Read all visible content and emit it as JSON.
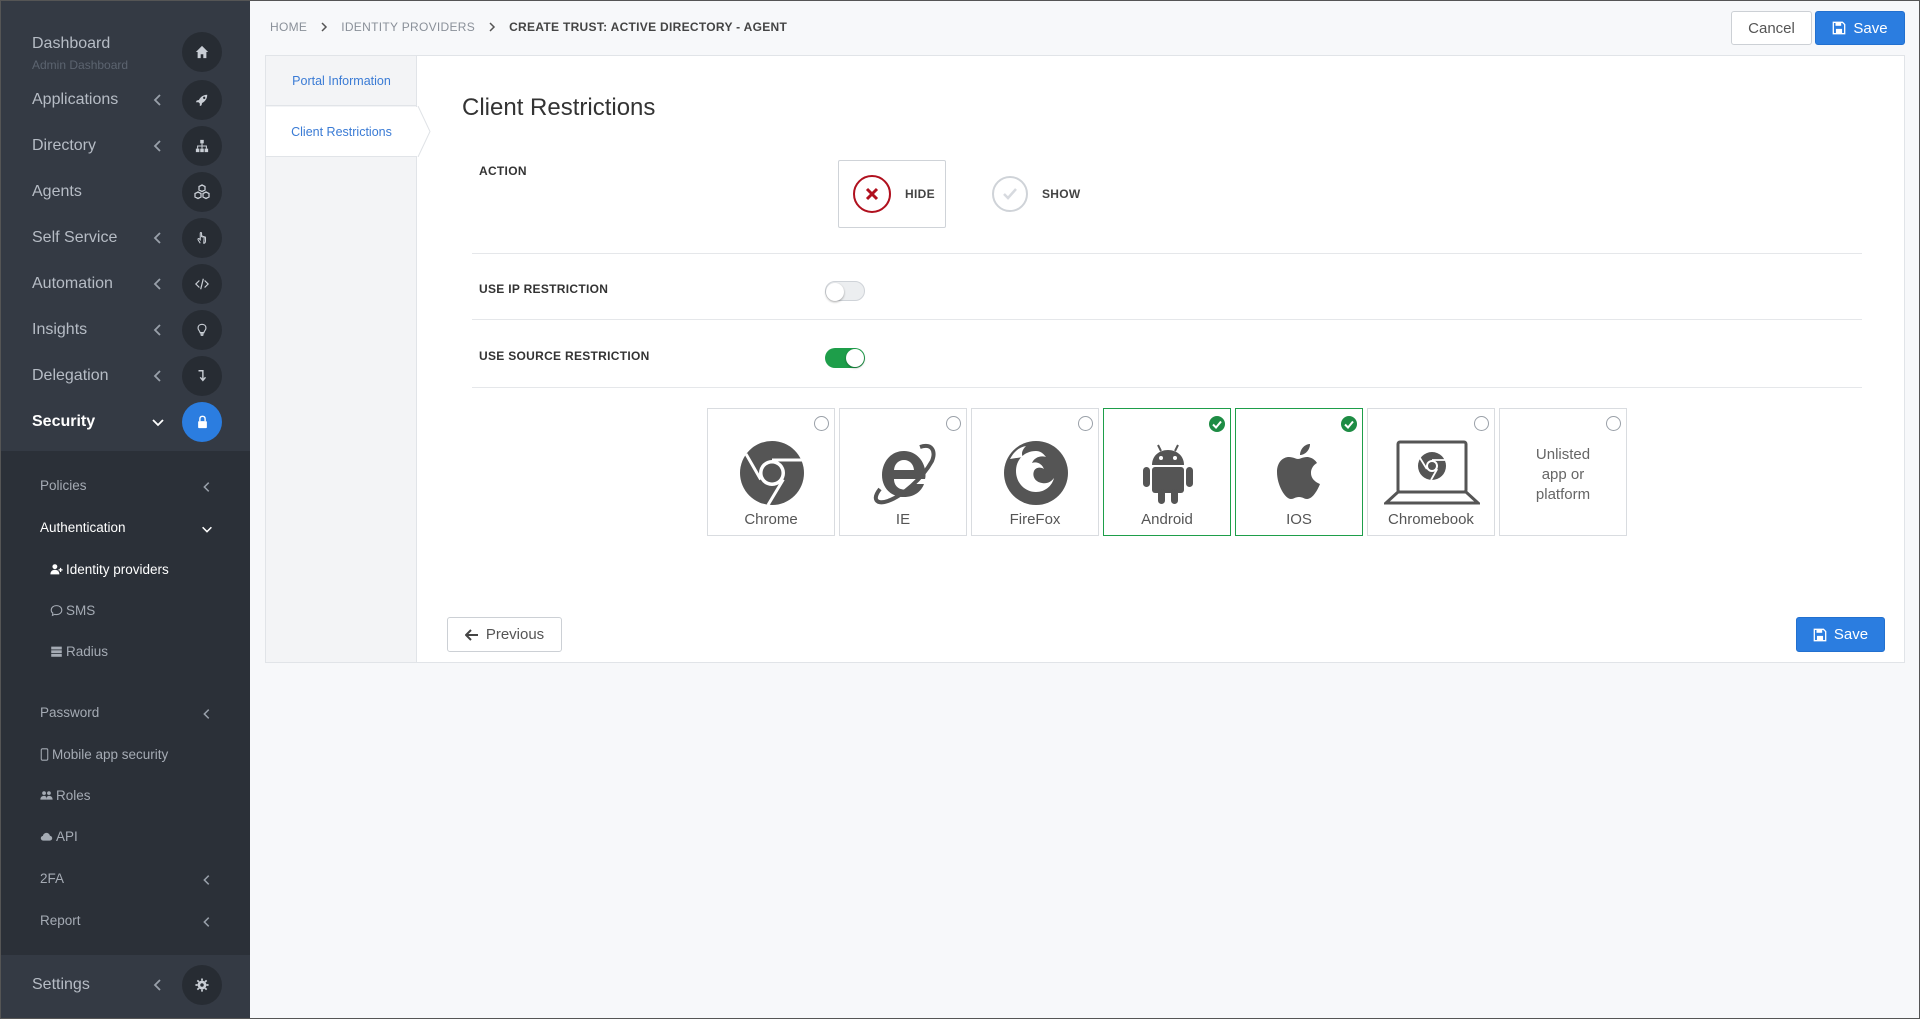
{
  "sidebar": {
    "dashboard": {
      "label": "Dashboard",
      "sub": "Admin Dashboard"
    },
    "items": [
      {
        "label": "Applications"
      },
      {
        "label": "Directory"
      },
      {
        "label": "Agents"
      },
      {
        "label": "Self Service"
      },
      {
        "label": "Automation"
      },
      {
        "label": "Insights"
      },
      {
        "label": "Delegation"
      },
      {
        "label": "Security"
      }
    ],
    "settings": {
      "label": "Settings"
    },
    "sub_items": {
      "policies": "Policies",
      "authentication": "Authentication",
      "identity_providers": "Identity providers",
      "sms": "SMS",
      "radius": "Radius",
      "password": "Password",
      "mobile_app_security": "Mobile app security",
      "roles": "Roles",
      "api": "API",
      "twofa": "2FA",
      "report": "Report"
    }
  },
  "breadcrumb": {
    "home": "HOME",
    "identity_providers": "IDENTITY PROVIDERS",
    "current": "CREATE TRUST: ACTIVE DIRECTORY - AGENT"
  },
  "toolbar": {
    "cancel": "Cancel",
    "save": "Save"
  },
  "tabs": {
    "portal_information": "Portal Information",
    "client_restrictions": "Client Restrictions"
  },
  "section": {
    "title": "Client Restrictions",
    "action_label": "ACTION",
    "hide_label": "HIDE",
    "show_label": "SHOW",
    "ip_restriction_label": "USE IP RESTRICTION",
    "source_restriction_label": "USE SOURCE RESTRICTION",
    "ip_restriction_enabled": false,
    "source_restriction_enabled": true,
    "selected_action": "HIDE"
  },
  "platforms": [
    {
      "name": "Chrome",
      "checked": false,
      "icon": "chrome-icon"
    },
    {
      "name": "IE",
      "checked": false,
      "icon": "internet-explorer-icon"
    },
    {
      "name": "FireFox",
      "checked": false,
      "icon": "firefox-icon"
    },
    {
      "name": "Android",
      "checked": true,
      "icon": "android-icon"
    },
    {
      "name": "IOS",
      "checked": true,
      "icon": "apple-icon"
    },
    {
      "name": "Chromebook",
      "checked": false,
      "icon": "chromebook-icon"
    },
    {
      "name": "Unlisted app or platform",
      "lines": [
        "Unlisted",
        "app or",
        "platform"
      ],
      "checked": false
    }
  ],
  "footer": {
    "previous": "Previous",
    "save": "Save"
  },
  "colors": {
    "sidebar_bg": "#343a44",
    "accent": "#2b7de0",
    "success": "#1e9e4a",
    "danger": "#b0101e"
  }
}
